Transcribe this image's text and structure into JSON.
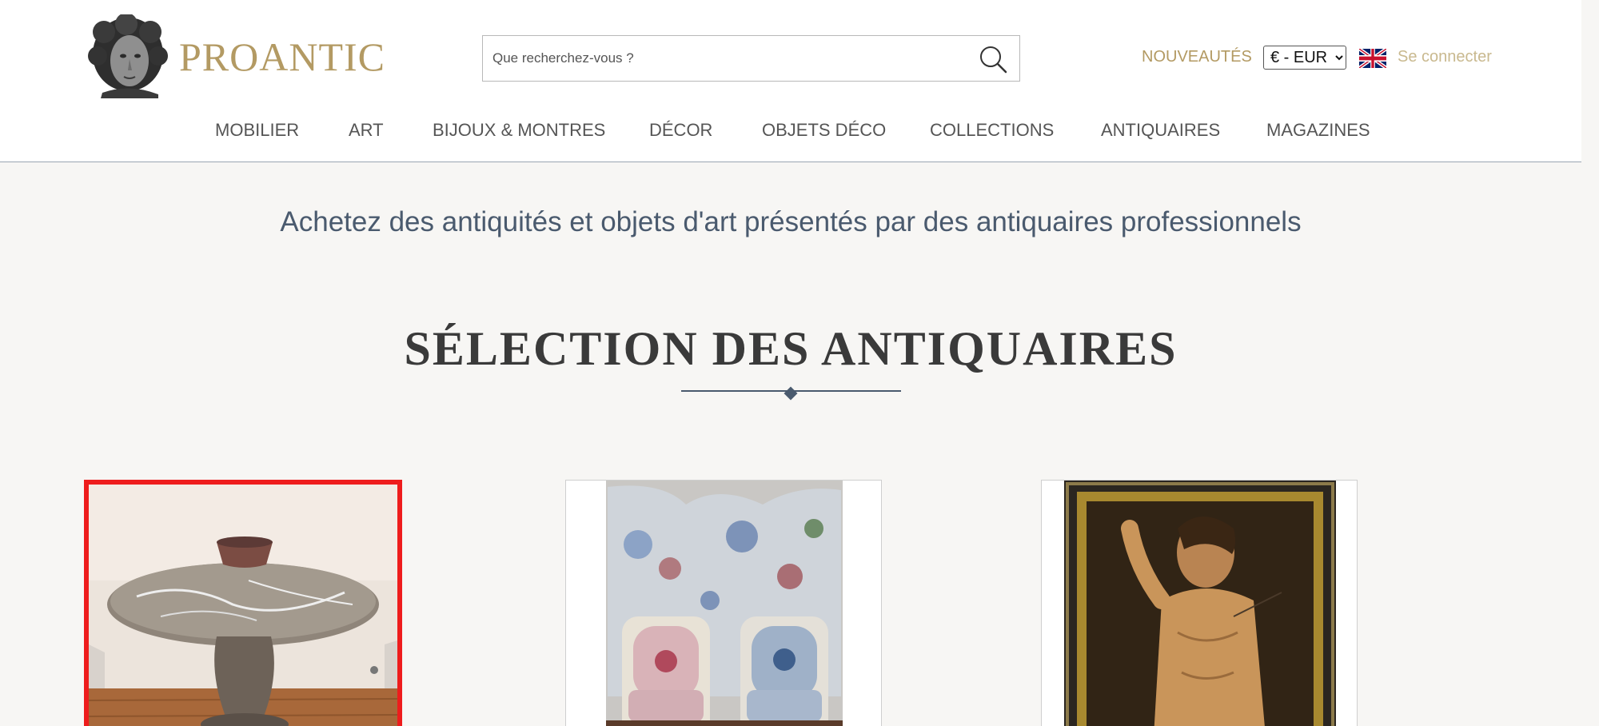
{
  "header": {
    "brand": "PROANTIC",
    "search": {
      "placeholder": "Que recherchez-vous ?"
    },
    "nouveautes_label": "NOUVEAUTÉS",
    "currency": {
      "selected": "€ - EUR"
    },
    "language_flag": "uk-flag-icon",
    "login_label": "Se connecter"
  },
  "nav": {
    "items": [
      {
        "label": "MOBILIER"
      },
      {
        "label": "ART"
      },
      {
        "label": "BIJOUX & MONTRES"
      },
      {
        "label": "DÉCOR"
      },
      {
        "label": "OBJETS DÉCO"
      },
      {
        "label": "COLLECTIONS"
      },
      {
        "label": "ANTIQUAIRES"
      },
      {
        "label": "MAGAZINES"
      }
    ]
  },
  "main": {
    "tagline": "Achetez des antiquités et objets d'art présentés par des antiquaires professionnels",
    "section_title": "SÉLECTION DES ANTIQUAIRES",
    "products": [
      {
        "image": "marble-table-with-bowl",
        "selected": true
      },
      {
        "image": "screen-and-armchairs",
        "selected": false
      },
      {
        "image": "saint-sebastian-painting",
        "selected": false
      }
    ]
  },
  "colors": {
    "brand_gold": "#b39a63",
    "tagline_blue": "#4a5a6e",
    "selection_red": "#ee1c1c",
    "background": "#f7f6f4"
  }
}
